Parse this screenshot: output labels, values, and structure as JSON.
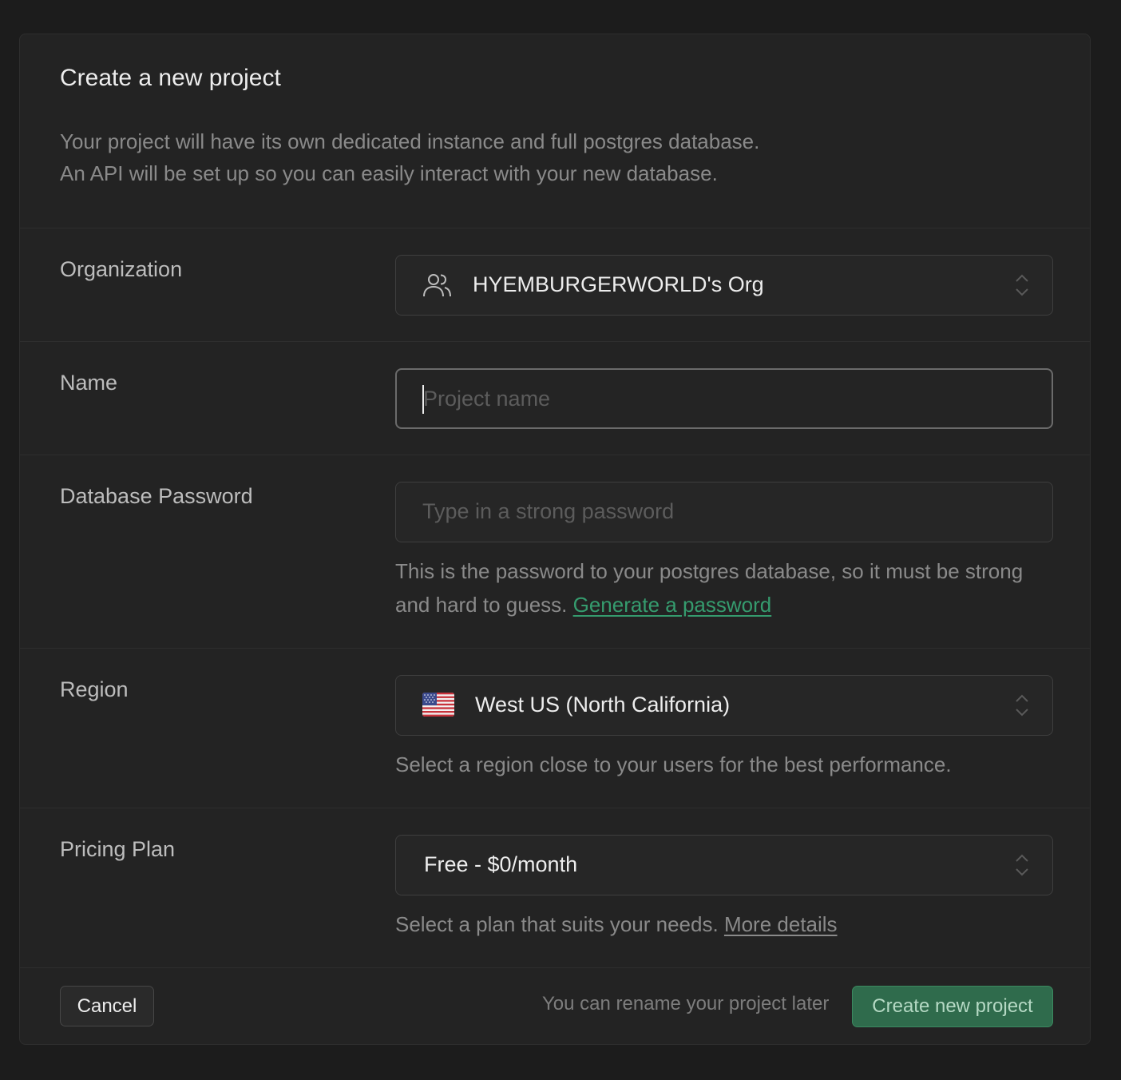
{
  "dialog": {
    "title": "Create a new project",
    "description_lines": [
      "Your project will have its own dedicated instance and full postgres database.",
      "An API will be set up so you can easily interact with your new database."
    ]
  },
  "organization": {
    "label": "Organization",
    "value": "HYEMBURGERWORLD's Org",
    "icon": "users-icon"
  },
  "name": {
    "label": "Name",
    "value": "",
    "placeholder": "Project name"
  },
  "password": {
    "label": "Database Password",
    "value": "",
    "placeholder": "Type in a strong password",
    "help_text": "This is the password to your postgres database, so it must be strong and hard to guess.",
    "help_link": "Generate a password"
  },
  "region": {
    "label": "Region",
    "value": "West US (North California)",
    "icon": "us-flag-icon",
    "help_text": "Select a region close to your users for the best performance."
  },
  "pricing": {
    "label": "Pricing Plan",
    "value": "Free - $0/month",
    "help_text": "Select a plan that suits your needs.",
    "help_link": "More details"
  },
  "footer": {
    "cancel_label": "Cancel",
    "note": "You can rename your project later",
    "create_label": "Create new project"
  },
  "colors": {
    "background": "#1c1c1c",
    "panel": "#232323",
    "accent_green": "#3ecf8e",
    "create_button": "#2f6b4c"
  }
}
